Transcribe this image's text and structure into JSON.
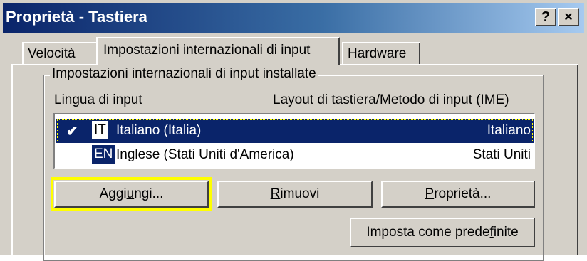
{
  "window": {
    "title": "Proprietà - Tastiera",
    "help_button": "?",
    "close_button": "×"
  },
  "tabs": [
    {
      "label": "Velocità",
      "active": false
    },
    {
      "label": "Impostazioni internazionali di input",
      "active": true
    },
    {
      "label": "Hardware",
      "active": false
    }
  ],
  "group": {
    "label": "Impostazioni internazionali di input installate",
    "col_language": "Lingua di input",
    "col_layout_first": "L",
    "col_layout_rest": "ayout di tastiera/Metodo di input (IME)"
  },
  "list": [
    {
      "check": "✔",
      "code": "IT",
      "language": "Italiano (Italia)",
      "layout": "Italiano",
      "selected": true
    },
    {
      "check": "",
      "code": "EN",
      "language": "Inglese (Stati Uniti d'America)",
      "layout": "Stati Uniti",
      "selected": false
    }
  ],
  "buttons": {
    "add_pre": "Aggi",
    "add_key": "u",
    "add_post": "ngi...",
    "remove_key": "R",
    "remove_post": "imuovi",
    "properties_key": "P",
    "properties_post": "roprietà...",
    "default_pre": "Imposta come prede",
    "default_key": "f",
    "default_post": "inite"
  },
  "colors": {
    "selection": "#0a246a",
    "highlight": "#ffff00",
    "face": "#d4d0c8"
  }
}
